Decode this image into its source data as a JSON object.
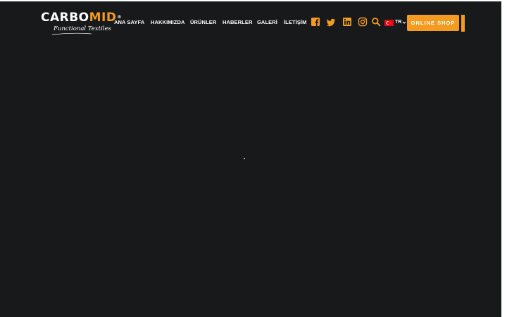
{
  "brand": {
    "logo_part1": "CARBO",
    "logo_part2": "MID",
    "registered_mark": "®",
    "tagline": "Functional Textiles"
  },
  "nav": {
    "home": "ANA SAYFA",
    "about": "HAKKIMIZDA",
    "products": "ÜRÜNLER",
    "news": "HABERLER",
    "gallery": "GALERİ",
    "contact": "İLETİŞİM"
  },
  "social_icons": [
    "facebook-icon",
    "twitter-icon",
    "linkedin-icon",
    "instagram-icon",
    "search-icon"
  ],
  "language": {
    "code": "TR",
    "flag": "turkey-flag-icon"
  },
  "shop_button": {
    "label": "ONLINE SHOP"
  },
  "colors": {
    "background": "#18191b",
    "accent": "#f39c1f",
    "text": "#ffffff"
  }
}
